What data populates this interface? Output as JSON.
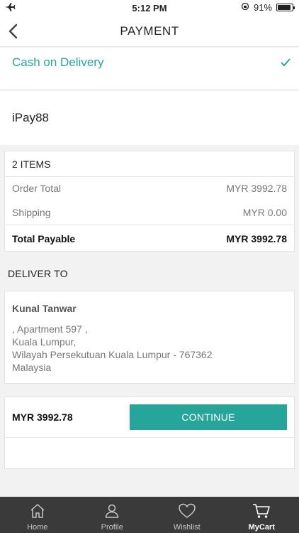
{
  "status_bar": {
    "time": "5:12 PM",
    "battery": "91%",
    "battery_level": 0.91
  },
  "nav": {
    "title": "PAYMENT"
  },
  "payment_options": [
    {
      "label": "Cash on Delivery",
      "selected": true
    },
    {
      "label": "iPay88",
      "selected": false
    }
  ],
  "summary": {
    "items": "2 ITEMS",
    "order_total_label": "Order Total",
    "order_total_value": "MYR 3992.78",
    "shipping_label": "Shipping",
    "shipping_value": "MYR 0.00",
    "total_label": "Total Payable",
    "total_value": "MYR 3992.78"
  },
  "deliver": {
    "heading": "DELIVER TO",
    "name": "Kunal Tanwar",
    "line1": ", Apartment 597 ,",
    "line2": "Kuala Lumpur,",
    "line3": "Wilayah Persekutuan Kuala Lumpur - 767362",
    "line4": "Malaysia"
  },
  "checkout": {
    "amount": "MYR 3992.78",
    "continue_label": "CONTINUE"
  },
  "tabs": [
    {
      "label": "Home",
      "icon": "home-icon",
      "active": false
    },
    {
      "label": "Profile",
      "icon": "profile-icon",
      "active": false
    },
    {
      "label": "Wishlist",
      "icon": "heart-icon",
      "active": false
    },
    {
      "label": "MyCart",
      "icon": "cart-icon",
      "active": true
    }
  ],
  "colors": {
    "accent": "#26a69a",
    "tabbar": "#3a3a3a"
  }
}
